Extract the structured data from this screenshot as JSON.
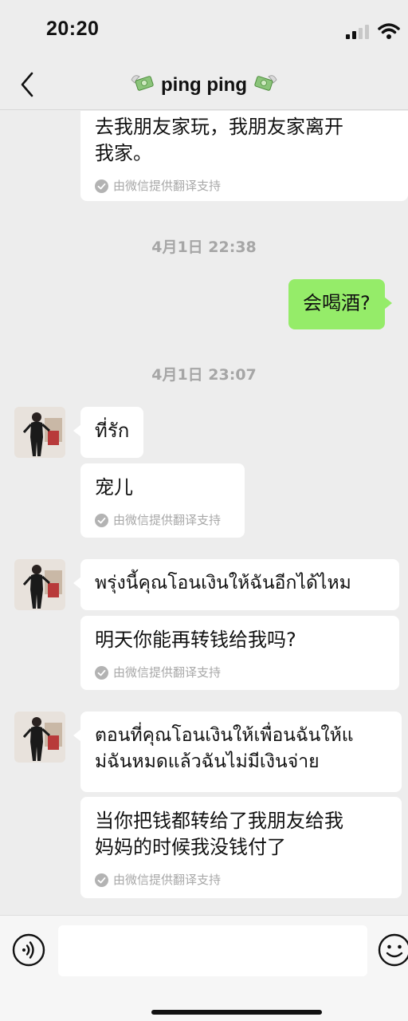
{
  "status_bar": {
    "time": "20:20"
  },
  "nav": {
    "title": "ping ping",
    "back_icon": "chevron-left-icon"
  },
  "messages": {
    "m1": {
      "text_line1": "去我朋友家玩，我朋友家离开",
      "text_line2": "我家。",
      "note": "由微信提供翻译支持"
    },
    "ts1": "4月1日 22:38",
    "m2": {
      "text": "会喝酒?"
    },
    "ts2": "4月1日 23:07",
    "m3": {
      "text": "ที่รัก"
    },
    "m4": {
      "text": "宠儿",
      "note": "由微信提供翻译支持"
    },
    "m5": {
      "text": "พรุ่งนี้คุณโอนเงินให้ฉันอีกได้ไหม"
    },
    "m6": {
      "text": "明天你能再转钱给我吗?",
      "note": "由微信提供翻译支持"
    },
    "m7": {
      "text_line1": "ตอนที่คุณโอนเงินให้เพื่อนฉันให้แ",
      "text_line2": "ม่ฉันหมดแล้วฉันไม่มีเงินจ่าย"
    },
    "m8": {
      "text_line1": "当你把钱都转给了我朋友给我",
      "text_line2": "妈妈的时候我没钱付了",
      "note": "由微信提供翻译支持"
    }
  },
  "input": {
    "placeholder": ""
  },
  "colors": {
    "sent_bubble": "#95ec69",
    "received_bubble": "#ffffff",
    "background": "#ededed"
  }
}
